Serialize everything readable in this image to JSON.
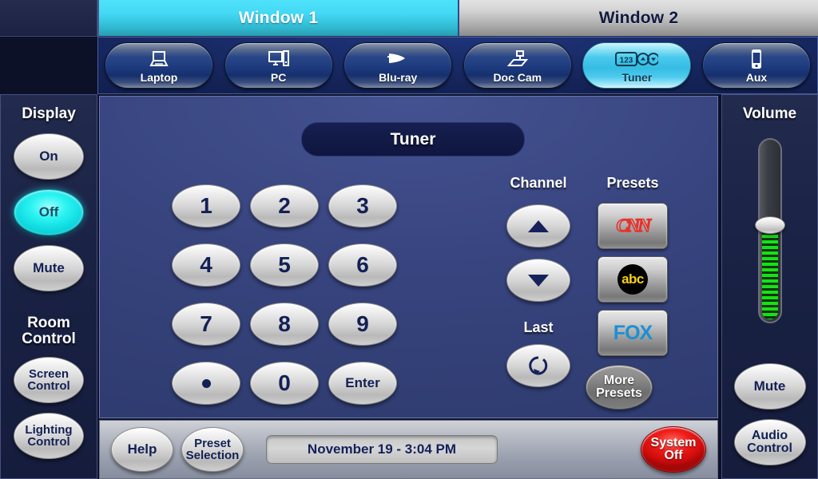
{
  "window_tabs": [
    {
      "label": "Window 1",
      "active": true
    },
    {
      "label": "Window 2",
      "active": false
    }
  ],
  "sources": [
    {
      "label": "Laptop",
      "icon": "laptop-icon",
      "active": false
    },
    {
      "label": "PC",
      "icon": "desktop-pc-icon",
      "active": false
    },
    {
      "label": "Blu-ray",
      "icon": "bluray-icon",
      "active": false
    },
    {
      "label": "Doc Cam",
      "icon": "document-camera-icon",
      "active": false
    },
    {
      "label": "Tuner",
      "icon": "tuner-icon",
      "active": true
    },
    {
      "label": "Aux",
      "icon": "mobile-device-icon",
      "active": false
    }
  ],
  "left_sidebar": {
    "display_title": "Display",
    "display_buttons": [
      {
        "label": "On",
        "active": false
      },
      {
        "label": "Off",
        "active": true
      },
      {
        "label": "Mute",
        "active": false
      }
    ],
    "room_title_line1": "Room",
    "room_title_line2": "Control",
    "room_buttons": [
      {
        "line1": "Screen",
        "line2": "Control"
      },
      {
        "line1": "Lighting",
        "line2": "Control"
      }
    ]
  },
  "right_sidebar": {
    "volume_title": "Volume",
    "volume_level": 53,
    "buttons": [
      {
        "line1": "Mute",
        "line2": ""
      },
      {
        "line1": "Audio",
        "line2": "Control"
      }
    ]
  },
  "main": {
    "title": "Tuner",
    "keypad": [
      {
        "label": "1",
        "kind": "digit"
      },
      {
        "label": "2",
        "kind": "digit"
      },
      {
        "label": "3",
        "kind": "digit"
      },
      {
        "label": "4",
        "kind": "digit"
      },
      {
        "label": "5",
        "kind": "digit"
      },
      {
        "label": "6",
        "kind": "digit"
      },
      {
        "label": "7",
        "kind": "digit"
      },
      {
        "label": "8",
        "kind": "digit"
      },
      {
        "label": "9",
        "kind": "digit"
      },
      {
        "label": "",
        "kind": "dot"
      },
      {
        "label": "0",
        "kind": "digit"
      },
      {
        "label": "Enter",
        "kind": "text"
      }
    ],
    "channel_label": "Channel",
    "channel_up_icon": "triangle-up-icon",
    "channel_down_icon": "triangle-down-icon",
    "last_label": "Last",
    "last_icon": "circular-arrow-icon",
    "presets_label": "Presets",
    "presets": [
      {
        "name": "CNN",
        "logo": "cnn-logo"
      },
      {
        "name": "abc",
        "logo": "abc-logo"
      },
      {
        "name": "FOX",
        "logo": "fox-logo"
      }
    ],
    "more_presets_line1": "More",
    "more_presets_line2": "Presets"
  },
  "bottom_bar": {
    "help_label": "Help",
    "preset_selection_line1": "Preset",
    "preset_selection_line2": "Selection",
    "datetime": "November 19  -  3:04 PM",
    "system_off_line1": "System",
    "system_off_line2": "Off"
  },
  "colors": {
    "active_tab": "#43d8f4",
    "active_source": "#49c9ec",
    "display_off_active": "#2ef4f2",
    "system_off": "#ef1b18",
    "volume_fill": "#18e018",
    "panel_blue": "#37447e"
  }
}
